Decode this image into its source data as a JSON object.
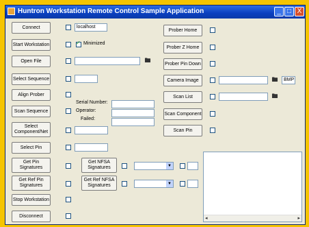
{
  "window": {
    "title": "Huntron Workstation Remote Control Sample Application"
  },
  "title_controls": {
    "minimize": "_",
    "maximize": "□",
    "close": "X"
  },
  "buttons": {
    "connect": "Connect",
    "start_workstation": "Start Workstation",
    "open_file": "Open File",
    "select_sequence": "Select Sequence",
    "align_prober": "Align Prober",
    "scan_sequence": "Scan Sequence",
    "select_component_net": "Select Component/Net",
    "select_pin": "Select Pin",
    "get_pin_signatures": "Get Pin Signatures",
    "get_ref_pin_signatures": "Get Ref Pin Signatures",
    "get_nfsa_signatures": "Get NFSA Signatures",
    "get_ref_nfsa_signatures": "Get Ref NFSA Signatures",
    "stop_workstation": "Stop Workstation",
    "disconnect": "Disconnect",
    "prober_home": "Prober Home",
    "prober_z_home": "Prober Z Home",
    "prober_pin_down": "Prober Pin Down",
    "camera_image": "Camera Image",
    "scan_list": "Scan List",
    "scan_component": "Scan Component",
    "scan_pin": "Scan Pin"
  },
  "fields": {
    "host": "localhost",
    "minimized_label": "Minimized",
    "serial_number_label": "Serial Number:",
    "operator_label": "Operator:",
    "failed_label": "Failed:",
    "image_format": "BMP"
  },
  "checkboxes": {
    "minimized_checked": true
  },
  "icons": {
    "folder_icon": "🖿",
    "app_icon": "app-icon"
  }
}
